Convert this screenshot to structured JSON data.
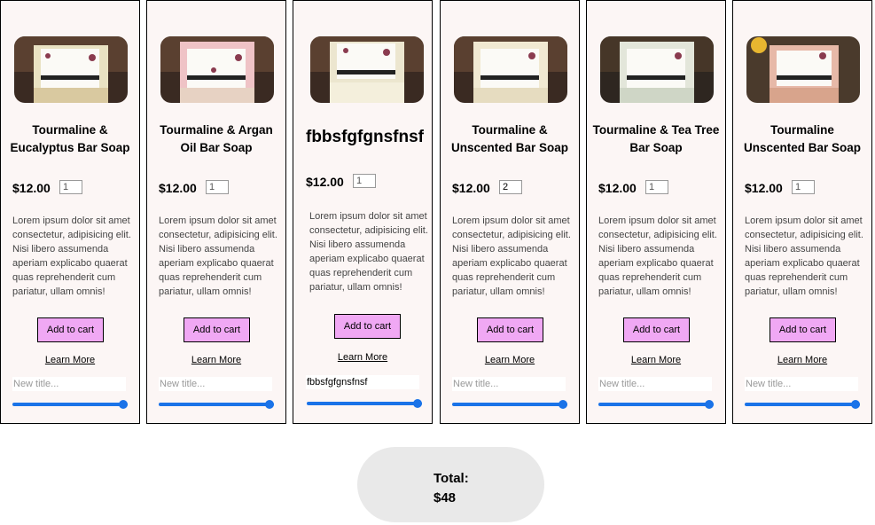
{
  "products": [
    {
      "name": "Tourmaline & Eucalyptus Bar Soap",
      "price": "$12.00",
      "qty": "1",
      "description": "Lorem ipsum dolor sit amet consectetur, adipisicing elit. Nisi libero assumenda aperiam explicabo quaerat quas reprehenderit cum pariatur, ullam omnis!",
      "add_label": "Add to cart",
      "more_label": "Learn More",
      "title_placeholder": "New title...",
      "title_value": "",
      "slider_percent": 100,
      "soap_colors": [
        "#e9e2c2",
        "#d9c9a0"
      ]
    },
    {
      "name": "Tourmaline & Argan Oil Bar Soap",
      "price": "$12.00",
      "qty": "1",
      "description": "Lorem ipsum dolor sit amet consectetur, adipisicing elit. Nisi libero assumenda aperiam explicabo quaerat quas reprehenderit cum pariatur, ullam omnis!",
      "add_label": "Add to cart",
      "more_label": "Learn More",
      "title_placeholder": "New title...",
      "title_value": "",
      "slider_percent": 100,
      "soap_colors": [
        "#efc3c6",
        "#e7d2c3"
      ]
    },
    {
      "name": "fbbsfgfgnsfnsf",
      "price": "$12.00",
      "qty": "1",
      "description": "Lorem ipsum dolor sit amet consectetur, adipisicing elit. Nisi libero assumenda aperiam explicabo quaerat quas reprehenderit cum pariatur, ullam omnis!",
      "add_label": "Add to cart",
      "more_label": "Learn More",
      "title_placeholder": "New title...",
      "title_value": "fbbsfgfgnsfnsf",
      "slider_percent": 100,
      "soap_colors": [
        "#ece6cf",
        "#f4efdc"
      ]
    },
    {
      "name": "Tourmaline & Unscented Bar Soap",
      "price": "$12.00",
      "qty": "2",
      "description": "Lorem ipsum dolor sit amet consectetur, adipisicing elit. Nisi libero assumenda aperiam explicabo quaerat quas reprehenderit cum pariatur, ullam omnis!",
      "add_label": "Add to cart",
      "more_label": "Learn More",
      "title_placeholder": "New title...",
      "title_value": "",
      "slider_percent": 100,
      "soap_colors": [
        "#f1e9d2",
        "#e6dcc0"
      ]
    },
    {
      "name": "Tourmaline & Tea Tree Bar Soap",
      "price": "$12.00",
      "qty": "1",
      "description": "Lorem ipsum dolor sit amet consectetur, adipisicing elit. Nisi libero assumenda aperiam explicabo quaerat quas reprehenderit cum pariatur, ullam omnis!",
      "add_label": "Add to cart",
      "more_label": "Learn More",
      "title_placeholder": "New title...",
      "title_value": "",
      "slider_percent": 100,
      "soap_colors": [
        "#e3e6da",
        "#cfd6c6"
      ]
    },
    {
      "name": "Tourmaline Unscented Bar Soap",
      "price": "$12.00",
      "qty": "1",
      "description": "Lorem ipsum dolor sit amet consectetur, adipisicing elit. Nisi libero assumenda aperiam explicabo quaerat quas reprehenderit cum pariatur, ullam omnis!",
      "add_label": "Add to cart",
      "more_label": "Learn More",
      "title_placeholder": "New title...",
      "title_value": "",
      "slider_percent": 100,
      "soap_colors": [
        "#e7b9a8",
        "#d8a48c"
      ]
    }
  ],
  "total": {
    "label": "Total:",
    "amount": "$48"
  },
  "colors": {
    "button": "#f0a8f4",
    "slider": "#1a73e8",
    "card_bg": "#fcf6f5"
  }
}
